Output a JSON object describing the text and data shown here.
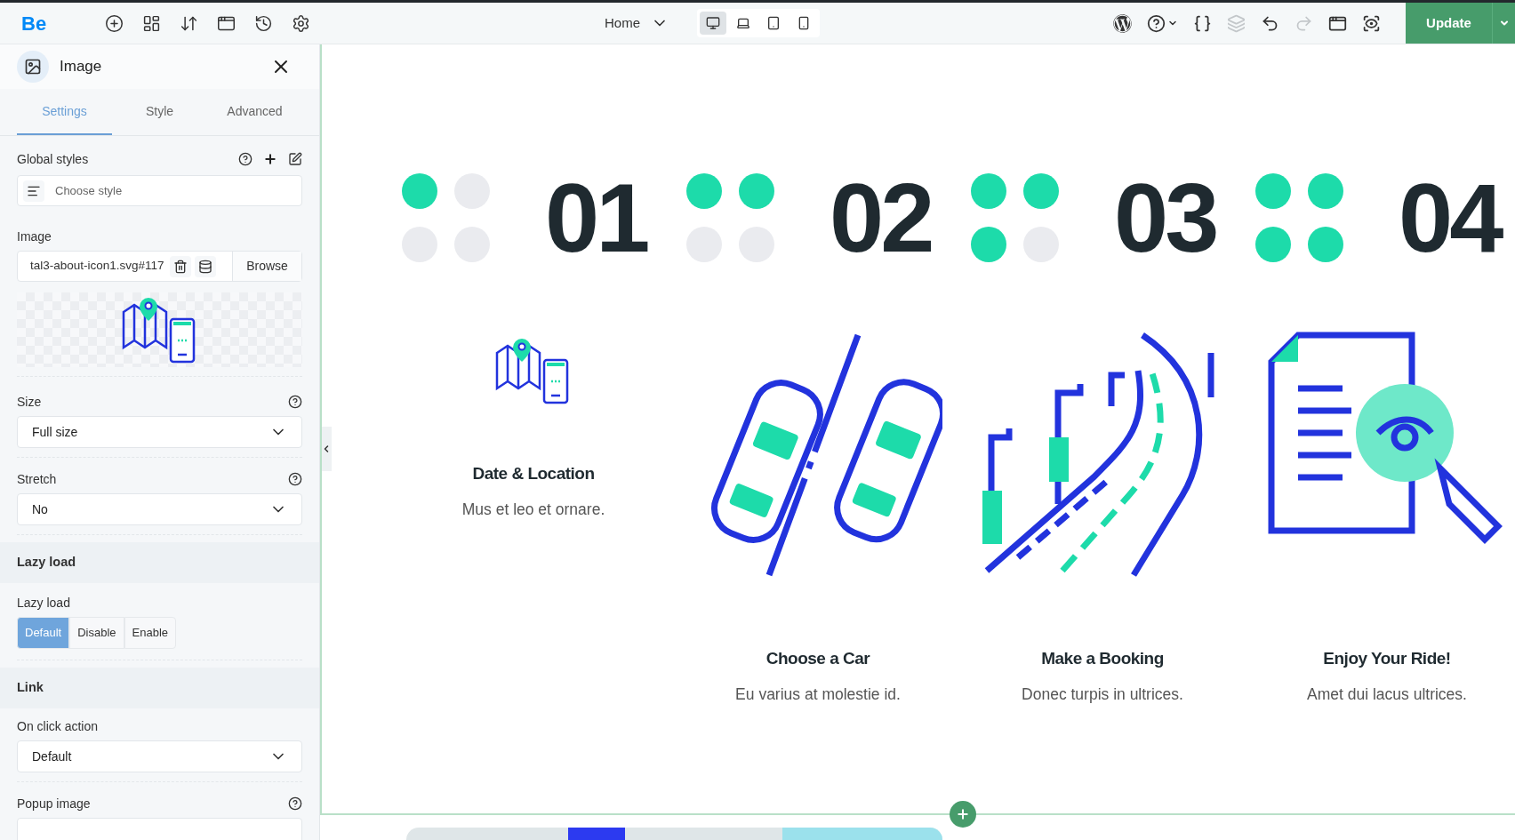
{
  "toolbar": {
    "logo": "Be",
    "left_tools": [
      {
        "kind": "add"
      },
      {
        "kind": "layout"
      },
      {
        "kind": "sort"
      },
      {
        "kind": "template"
      },
      {
        "kind": "history"
      },
      {
        "kind": "settings"
      }
    ],
    "page": "Home",
    "devices": [
      {
        "kind": "desktop",
        "selected": true
      },
      {
        "kind": "laptop",
        "selected": false
      },
      {
        "kind": "tablet",
        "selected": false
      },
      {
        "kind": "mobile",
        "selected": false
      }
    ],
    "right_tools": [
      {
        "kind": "wordpress",
        "disabled": false
      },
      {
        "kind": "help",
        "disabled": false
      },
      {
        "kind": "css",
        "disabled": false
      },
      {
        "kind": "layers",
        "disabled": true
      },
      {
        "kind": "undo",
        "disabled": false
      },
      {
        "kind": "redo",
        "disabled": true
      },
      {
        "kind": "preview",
        "disabled": false
      },
      {
        "kind": "eye",
        "disabled": false
      }
    ],
    "update_button": "Update"
  },
  "sidebar": {
    "title": "Image",
    "tabs": [
      {
        "label": "Settings",
        "selected": true
      },
      {
        "label": "Style",
        "selected": false
      },
      {
        "label": "Advanced",
        "selected": false
      }
    ],
    "global_styles": {
      "label": "Global styles",
      "placeholder": "Choose style"
    },
    "image": {
      "label": "Image",
      "value": "tal3-about-icon1.svg#117",
      "browse": "Browse"
    },
    "size": {
      "label": "Size",
      "value": "Full size"
    },
    "stretch": {
      "label": "Stretch",
      "value": "No"
    },
    "lazy_section": "Lazy load",
    "lazy_load": {
      "label": "Lazy load",
      "options": [
        {
          "label": "Default",
          "selected": true
        },
        {
          "label": "Disable",
          "selected": false
        },
        {
          "label": "Enable",
          "selected": false
        }
      ]
    },
    "link_section": "Link",
    "on_click": {
      "label": "On click action",
      "value": "Default"
    },
    "popup_image": {
      "label": "Popup image"
    }
  },
  "steps": [
    {
      "number": "01",
      "dots": [
        true,
        false,
        false,
        false
      ]
    },
    {
      "number": "02",
      "dots": [
        true,
        true,
        false,
        false
      ]
    },
    {
      "number": "03",
      "dots": [
        true,
        true,
        true,
        false
      ]
    },
    {
      "number": "04",
      "dots": [
        true,
        true,
        true,
        true
      ]
    }
  ],
  "cards": [
    {
      "kind": "map",
      "title": "Date & Location",
      "text": "Mus et leo et ornare."
    },
    {
      "kind": "cars",
      "title": "Choose a Car",
      "text": "Eu varius at molestie id."
    },
    {
      "kind": "road",
      "title": "Make a Booking",
      "text": "Donec turpis in ultrices."
    },
    {
      "kind": "document",
      "title": "Enjoy Your Ride!",
      "text": "Amet dui lacus ultrices."
    }
  ]
}
